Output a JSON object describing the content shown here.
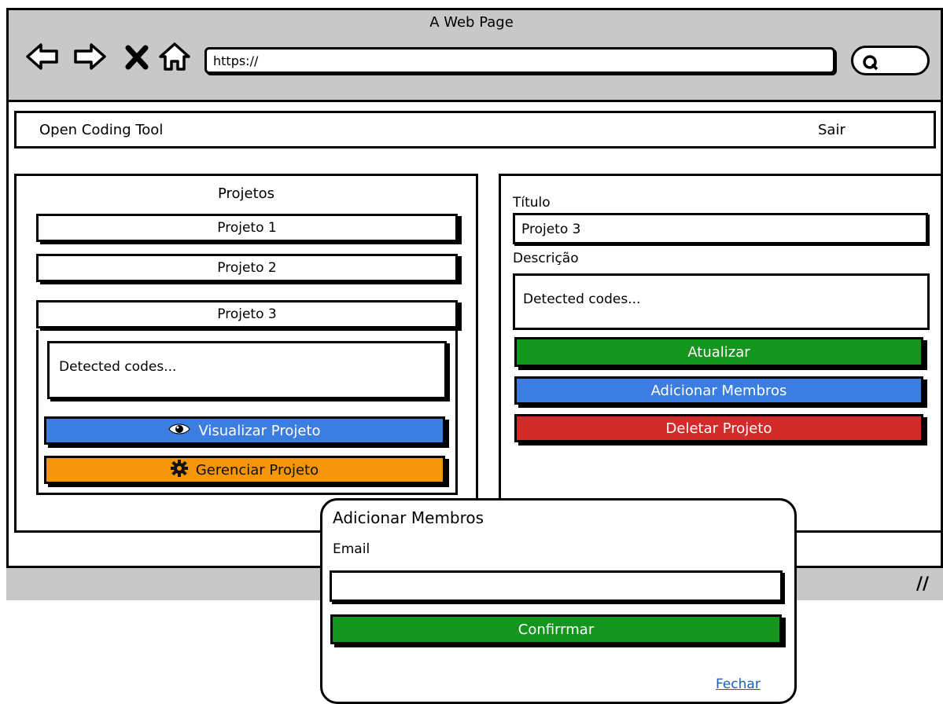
{
  "browser": {
    "window_title": "A Web Page",
    "url": "https://",
    "nav_icons": [
      "back-arrow-icon",
      "forward-arrow-icon",
      "stop-icon",
      "home-icon"
    ],
    "search_icon": "search-icon",
    "resize_glyph": "//"
  },
  "header": {
    "app_name": "Open Coding Tool",
    "logout": "Sair"
  },
  "projects": {
    "heading": "Projetos",
    "items": [
      "Projeto 1",
      "Projeto 2",
      "Projeto 3"
    ],
    "expanded_description": "Detected codes...",
    "view_button": "Visualizar Projeto",
    "manage_button": "Gerenciar Projeto"
  },
  "details": {
    "title_label": "Título",
    "title_value": "Projeto 3",
    "description_label": "Descrição",
    "description_value": "Detected codes...",
    "update_button": "Atualizar",
    "add_members_button": "Adicionar Membros",
    "delete_button": "Deletar Projeto"
  },
  "modal": {
    "title": "Adicionar Membros",
    "email_label": "Email",
    "email_value": "",
    "confirm_button": "Confirrmar",
    "close_link": "Fechar"
  },
  "colors": {
    "green": "#14951e",
    "blue": "#3b7de0",
    "red": "#d32a2a",
    "orange": "#f5960a",
    "chrome_gray": "#c8c8c8",
    "link": "#1a5fb4"
  }
}
